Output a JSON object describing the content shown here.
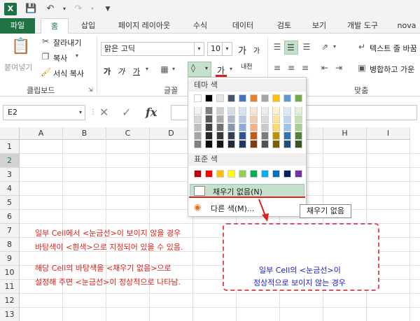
{
  "quick_access": {
    "app_letter": "X"
  },
  "tabs": [
    {
      "label": "파일"
    },
    {
      "label": "홈"
    },
    {
      "label": "삽입"
    },
    {
      "label": "페이지 레이아웃"
    },
    {
      "label": "수식"
    },
    {
      "label": "데이터"
    },
    {
      "label": "검토"
    },
    {
      "label": "보기"
    },
    {
      "label": "개발 도구"
    },
    {
      "label": "nova"
    }
  ],
  "ribbon": {
    "paste_label": "붙여넣기",
    "cut_label": "잘라내기",
    "copy_label": "복사",
    "format_painter_label": "서식 복사",
    "clipboard_group": "클립보드",
    "font_name": "맑은 고딕",
    "font_size": "10",
    "grow_font": "가",
    "shrink_font": "가",
    "bold": "가",
    "italic": "가",
    "underline": "가",
    "font_color_glyph": "가",
    "phonetic": "내천",
    "font_group": "글꼴",
    "wrap_text_label": "텍스트 줄 바꿈",
    "merge_label": "병합하고 가운",
    "align_group": "맞춤"
  },
  "formula_bar": {
    "name_box": "E2",
    "fx": "fx"
  },
  "grid": {
    "columns": [
      "A",
      "B",
      "C",
      "D",
      "E",
      "F",
      "G",
      "H",
      "I"
    ],
    "rows": [
      "1",
      "2",
      "3",
      "4",
      "5",
      "6",
      "7",
      "8",
      "9",
      "10",
      "11",
      "12",
      "13"
    ],
    "selected_row": "2"
  },
  "notes": {
    "line1": "일부 Cell에서 <눈금선>이 보이지 않을 경우",
    "line2": "바탕색이 <흰색>으로 지정되어 있을 수 있음.",
    "line3": "해당 Cell의 바탕색을 <채우기 없음>으로",
    "line4": "설정해 주면 <눈금선>이 정상적으로 나타남.",
    "box_line1": "일부 Cell의 <눈금선>이",
    "box_line2": "정상적으로 보이지 않는 경우"
  },
  "dropdown": {
    "theme_header": "테마 색",
    "standard_header": "표준 색",
    "no_fill": "채우기 없음(N)",
    "more_colors": "다른 색(M)..."
  },
  "tooltip": "채우기 없음",
  "colors": {
    "theme_top": [
      "#ffffff",
      "#000000",
      "#e7e6e6",
      "#44546a",
      "#4472c4",
      "#ed7d31",
      "#a5a5a5",
      "#ffc000",
      "#5b9bd5",
      "#70ad47"
    ],
    "theme_shades": [
      [
        "#f2f2f2",
        "#7f7f7f",
        "#d0cece",
        "#d6dce4",
        "#d9e2f3",
        "#fbe5d5",
        "#ededed",
        "#fff2cc",
        "#deebf6",
        "#e2efd9"
      ],
      [
        "#d8d8d8",
        "#595959",
        "#aeabab",
        "#adb9ca",
        "#b4c6e7",
        "#f7cbac",
        "#dbdbdb",
        "#fee599",
        "#bdd7ee",
        "#c5e0b3"
      ],
      [
        "#bfbfbf",
        "#3f3f3f",
        "#757070",
        "#8496b0",
        "#8eaadb",
        "#f4b183",
        "#c9c9c9",
        "#ffd966",
        "#9cc3e5",
        "#a8d08d"
      ],
      [
        "#a5a5a5",
        "#262626",
        "#3a3838",
        "#323f4f",
        "#2f5496",
        "#c55a11",
        "#7b7b7b",
        "#bf9000",
        "#2e75b5",
        "#538135"
      ],
      [
        "#7f7f7f",
        "#0c0c0c",
        "#171616",
        "#222a35",
        "#1f3864",
        "#833c0b",
        "#525252",
        "#7f6000",
        "#1e4e79",
        "#375623"
      ]
    ],
    "standard": [
      "#c00000",
      "#ff0000",
      "#ffc000",
      "#ffff00",
      "#92d050",
      "#00b050",
      "#00b0f0",
      "#0070c0",
      "#002060",
      "#7030a0"
    ],
    "accent": "#217346"
  }
}
